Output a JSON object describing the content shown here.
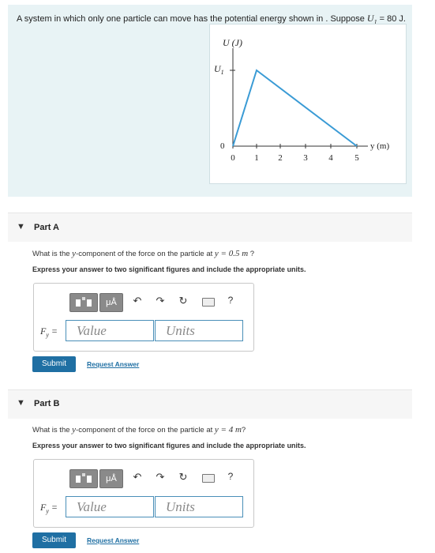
{
  "problem": {
    "text_before": "A system in which only one particle can move has the potential energy shown in . Suppose ",
    "var": "U",
    "sub": "1",
    "text_after": " = 80 J."
  },
  "graph": {
    "y_axis_label": "U (J)",
    "u1_label": "U",
    "u1_sub": "1",
    "x_axis_label": "y (m)",
    "origin_label": "0",
    "x_ticks": [
      "0",
      "1",
      "2",
      "3",
      "4",
      "5"
    ],
    "line_color": "#3a9bd5"
  },
  "parts": [
    {
      "title": "Part A",
      "question_before": "What is the ",
      "question_var": "y",
      "question_mid": "-component of the force on the particle at ",
      "question_value": "y = 0.5 m",
      "question_after": " ?",
      "instruction": "Express your answer to two significant figures and include the appropriate units.",
      "toolbar": {
        "mu_label": "μÅ",
        "help_label": "?"
      },
      "input_label": "Fy =",
      "value_placeholder": "Value",
      "units_placeholder": "Units",
      "submit_label": "Submit",
      "request_label": "Request Answer"
    },
    {
      "title": "Part B",
      "question_before": "What is the ",
      "question_var": "y",
      "question_mid": "-component of the force on the particle at ",
      "question_value": "y = 4 m",
      "question_after": "?",
      "instruction": "Express your answer to two significant figures and include the appropriate units.",
      "toolbar": {
        "mu_label": "μÅ",
        "help_label": "?"
      },
      "input_label": "Fy =",
      "value_placeholder": "Value",
      "units_placeholder": "Units",
      "submit_label": "Submit",
      "request_label": "Request Answer"
    }
  ]
}
